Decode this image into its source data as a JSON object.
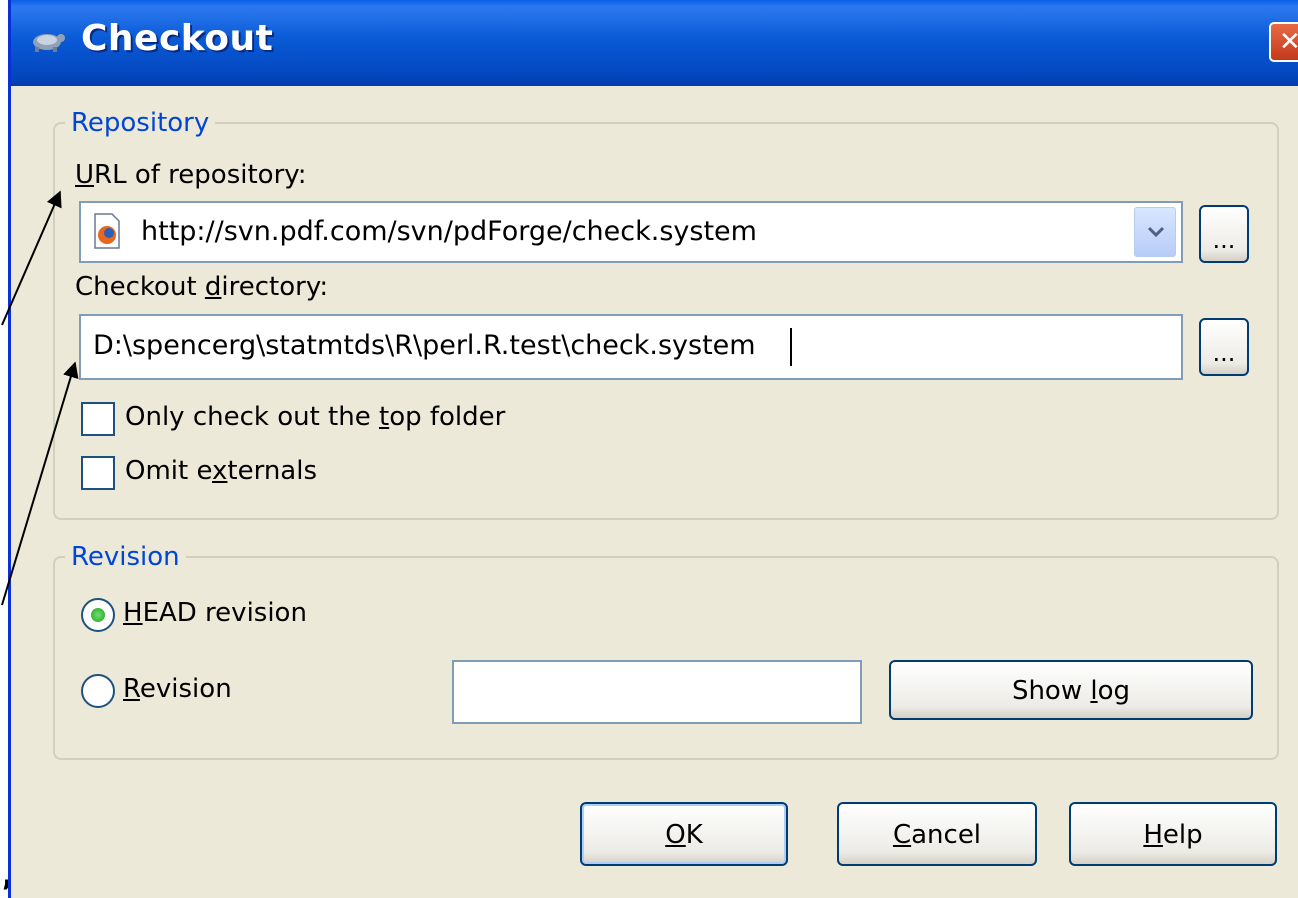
{
  "window": {
    "title": "Checkout",
    "close_glyph": "✕"
  },
  "repository": {
    "legend": "Repository",
    "url_label_accel": "U",
    "url_label_rest": "RL of repository:",
    "url_value": "http://svn.pdf.com/svn/pdForge/check.system",
    "browse_label": "...",
    "dir_label_pre": "Checkout ",
    "dir_label_accel": "d",
    "dir_label_post": "irectory:",
    "dir_value": "D:\\spencerg\\statmtds\\R\\perl.R.test\\check.system",
    "dir_browse_label": "...",
    "top_folder_pre": "Only check out the ",
    "top_folder_accel": "t",
    "top_folder_post": "op folder",
    "externals_pre": "Omit e",
    "externals_accel": "x",
    "externals_post": "ternals"
  },
  "revision": {
    "legend": "Revision",
    "head_accel": "H",
    "head_rest": "EAD revision",
    "rev_accel": "R",
    "rev_rest": "evision",
    "rev_value": "",
    "show_log_pre": "Show ",
    "show_log_accel": "l",
    "show_log_post": "og"
  },
  "buttons": {
    "ok_accel": "O",
    "ok_rest": "K",
    "cancel_accel": "C",
    "cancel_rest": "ancel",
    "help_accel": "H",
    "help_rest": "elp"
  },
  "stray_char": ","
}
